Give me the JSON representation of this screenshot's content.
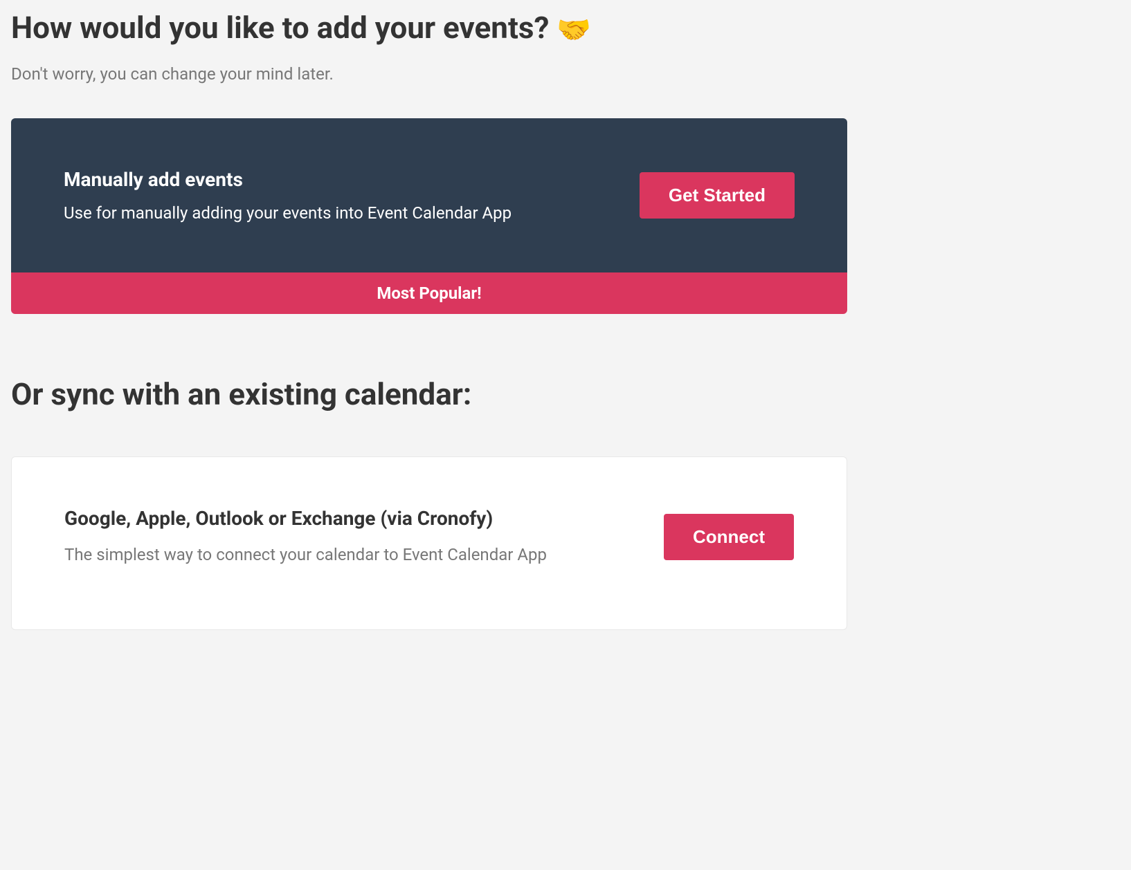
{
  "header": {
    "title": "How would you like to add your events? ",
    "emoji": "🤝",
    "subtitle": "Don't worry, you can change your mind later."
  },
  "manualCard": {
    "title": "Manually add events",
    "description": "Use for manually adding your events into Event Calendar App",
    "buttonLabel": "Get Started",
    "badge": "Most Popular!"
  },
  "syncSection": {
    "heading": "Or sync with an existing calendar:"
  },
  "cronofyCard": {
    "title": "Google, Apple, Outlook or Exchange (via Cronofy)",
    "description": "The simplest way to connect your calendar to Event Calendar App",
    "buttonLabel": "Connect"
  }
}
